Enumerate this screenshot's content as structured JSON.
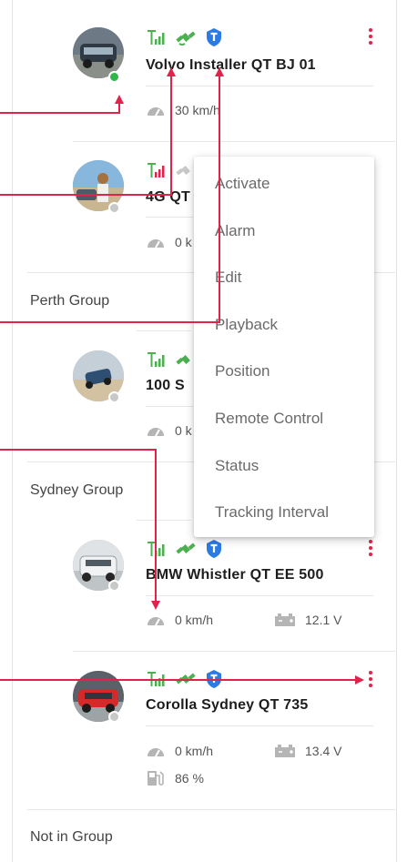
{
  "colors": {
    "accent": "#e0234b",
    "signal": "#4caf50",
    "shield": "#2c7be5",
    "online": "#2fb84a",
    "offline": "#c8c8c8"
  },
  "groups": [
    {
      "label": "Perth Group"
    },
    {
      "label": "Sydney Group"
    },
    {
      "label": "Not in Group"
    }
  ],
  "vehicles": [
    {
      "name": "Volvo Installer QT BJ 01",
      "speed": "30 km/h",
      "status": "online",
      "icons": [
        "signal-icon",
        "satellite-icon",
        "shield-icon"
      ]
    },
    {
      "name": "4G QT",
      "speed": "0 k",
      "status": "offline",
      "icons": [
        "signal-icon",
        "satellite-icon"
      ]
    },
    {
      "name": "100 S",
      "speed": "0 k",
      "status": "offline",
      "icons": [
        "signal-icon",
        "satellite-icon"
      ]
    },
    {
      "name": "BMW Whistler QT EE 500",
      "speed": "0 km/h",
      "voltage": "12.1 V",
      "status": "offline",
      "icons": [
        "signal-icon",
        "satellite-icon",
        "shield-icon"
      ]
    },
    {
      "name": "Corolla Sydney QT 735",
      "speed": "0 km/h",
      "voltage": "13.4 V",
      "fuel": "86 %",
      "status": "offline",
      "icons": [
        "signal-icon",
        "satellite-icon",
        "shield-icon"
      ]
    }
  ],
  "context_menu": {
    "items": [
      "Activate",
      "Alarm",
      "Edit",
      "Playback",
      "Position",
      "Remote Control",
      "Status",
      "Tracking Interval"
    ]
  }
}
